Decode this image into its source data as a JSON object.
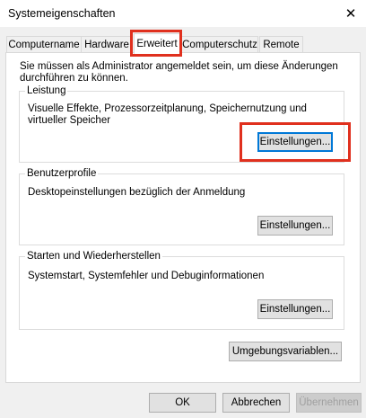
{
  "window": {
    "title": "Systemeigenschaften",
    "close_icon": "close-icon"
  },
  "tabs": [
    {
      "label": "Computername",
      "active": false
    },
    {
      "label": "Hardware",
      "active": false
    },
    {
      "label": "Erweitert",
      "active": true
    },
    {
      "label": "Computerschutz",
      "active": false
    },
    {
      "label": "Remote",
      "active": false
    }
  ],
  "main": {
    "intro": "Sie müssen als Administrator angemeldet sein, um diese Änderungen durchführen zu können.",
    "performance": {
      "title": "Leistung",
      "description": "Visuelle Effekte, Prozessorzeitplanung, Speichernutzung und virtueller Speicher",
      "button": "Einstellungen..."
    },
    "profiles": {
      "title": "Benutzerprofile",
      "description": "Desktopeinstellungen bezüglich der Anmeldung",
      "button": "Einstellungen..."
    },
    "startup": {
      "title": "Starten und Wiederherstellen",
      "description": "Systemstart, Systemfehler und Debuginformationen",
      "button": "Einstellungen..."
    },
    "env_button": "Umgebungsvariablen..."
  },
  "footer": {
    "ok": "OK",
    "cancel": "Abbrechen",
    "apply": "Übernehmen",
    "apply_enabled": false
  },
  "colors": {
    "highlight": "#e0301e",
    "focus": "#0078d7"
  }
}
